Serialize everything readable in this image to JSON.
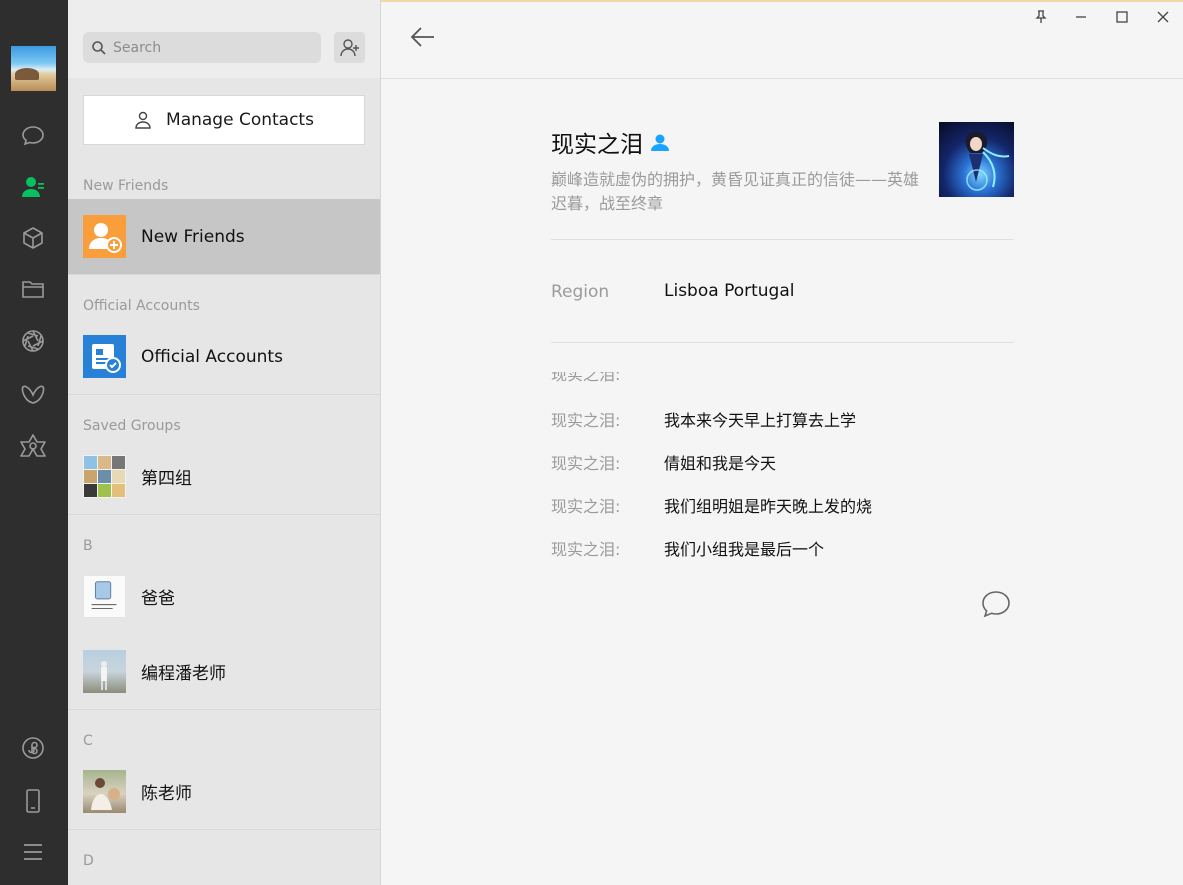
{
  "rail": {
    "user_avatar": "beach-avatar",
    "top_items": [
      {
        "name": "chats",
        "icon": "chat-bubble-icon",
        "active": false
      },
      {
        "name": "contacts",
        "icon": "contacts-icon",
        "active": true
      },
      {
        "name": "favorites",
        "icon": "cube-icon",
        "active": false
      },
      {
        "name": "files",
        "icon": "folder-icon",
        "active": false
      },
      {
        "name": "moments",
        "icon": "aperture-icon",
        "active": false
      },
      {
        "name": "channels",
        "icon": "butterfly-icon",
        "active": false
      },
      {
        "name": "search",
        "icon": "hexagram-icon",
        "active": false
      }
    ],
    "bottom_items": [
      {
        "name": "mini-programs",
        "icon": "mini-program-icon"
      },
      {
        "name": "phone",
        "icon": "phone-icon"
      },
      {
        "name": "more",
        "icon": "menu-icon"
      }
    ],
    "accent_color": "#07c160"
  },
  "search": {
    "placeholder": "Search"
  },
  "manage_contacts": {
    "label": "Manage Contacts"
  },
  "contact_list": {
    "sections": [
      {
        "label": "New Friends",
        "items": [
          {
            "name": "New Friends",
            "icon": "add-friend-icon",
            "color": "#fa9d3b",
            "selected": true
          }
        ]
      },
      {
        "label": "Official Accounts",
        "items": [
          {
            "name": "Official Accounts",
            "icon": "official-account-icon",
            "color": "#2782d7",
            "selected": false
          }
        ]
      },
      {
        "label": "Saved Groups",
        "items": [
          {
            "name": "第四组",
            "icon": "group-avatar",
            "selected": false
          }
        ]
      },
      {
        "label": "B",
        "items": [
          {
            "name": "爸爸",
            "icon": "contact-avatar",
            "selected": false
          },
          {
            "name": "编程潘老师",
            "icon": "contact-avatar",
            "selected": false
          }
        ]
      },
      {
        "label": "C",
        "items": [
          {
            "name": "陈老师",
            "icon": "contact-avatar",
            "selected": false
          }
        ]
      },
      {
        "label": "D",
        "items": []
      }
    ]
  },
  "profile": {
    "name": "现实之泪",
    "gender_icon": "male-icon",
    "gender_color": "#1aa3ff",
    "signature": "巅峰造就虚伪的拥护，黄昏见证真正的信徒——英雄迟暮，战至终章",
    "region_label": "Region",
    "region_value": "Lisboa Portugal",
    "avatar": "anime-avatar"
  },
  "messages": [
    {
      "sender": "现实之泪:",
      "text": "我本来今天早上打算去上学"
    },
    {
      "sender": "现实之泪:",
      "text": "倩姐和我是今天"
    },
    {
      "sender": "现实之泪:",
      "text": "我们组明姐是昨天晚上发的烧"
    },
    {
      "sender": "现实之泪:",
      "text": "我们小组我是最后一个"
    }
  ],
  "clipped_message_sender": "现实之泪:",
  "window_controls": [
    "pin-icon",
    "minimize-icon",
    "maximize-icon",
    "close-icon"
  ]
}
